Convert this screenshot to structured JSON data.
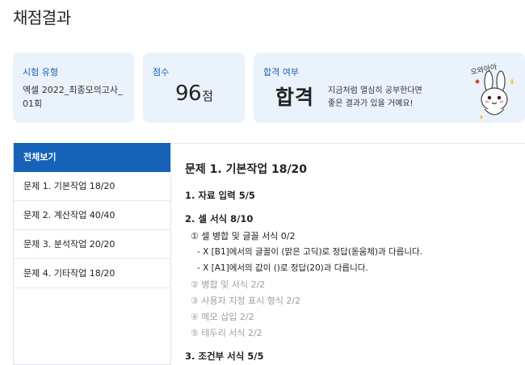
{
  "page": {
    "title": "채점결과"
  },
  "cards": {
    "exam": {
      "label": "시험 유형",
      "name": "엑셀 2022_최종모의고사_01회"
    },
    "score": {
      "label": "점수",
      "value": "96",
      "unit": "점"
    },
    "pass": {
      "label": "합격 여부",
      "result": "합격",
      "message_line1": "지금처럼 열심히 공부한다면",
      "message_line2": "좋은 결과가 있을 거예요!",
      "mascot_text": "오와아아"
    }
  },
  "sidebar": {
    "items": [
      {
        "label": "전체보기"
      },
      {
        "label": "문제 1. 기본작업 18/20"
      },
      {
        "label": "문제 2. 계산작업 40/40"
      },
      {
        "label": "문제 3. 분석작업 20/20"
      },
      {
        "label": "문제 4. 기타작업 18/20"
      }
    ]
  },
  "content": {
    "title": "문제 1. 기본작업 18/20",
    "sections": [
      {
        "title": "1. 자료 입력 5/5"
      },
      {
        "title": "2. 셀 서식 8/10",
        "items": [
          {
            "text": "① 셀 병합 및 글꼴 서식 0/2",
            "errors": [
              "- X [B1]에서의 글꼴이 (맑은 고딕)로 정답(돋움체)과 다릅니다.",
              "- X [A1]에서의 값이 ()로 정답(20)과 다릅니다."
            ]
          },
          {
            "text": "② 병합 및 서식 2/2"
          },
          {
            "text": "③ 사용자 지정 표시 형식 2/2"
          },
          {
            "text": "④ 메모 삽입 2/2"
          },
          {
            "text": "⑤ 테두리 서식 2/2"
          }
        ]
      },
      {
        "title": "3. 조건부 서식 5/5"
      }
    ]
  },
  "colors": {
    "accent": "#1562b8",
    "card_bg": "#eaf2fb",
    "label_blue": "#1a5fb4",
    "muted": "#9aa0a6"
  }
}
